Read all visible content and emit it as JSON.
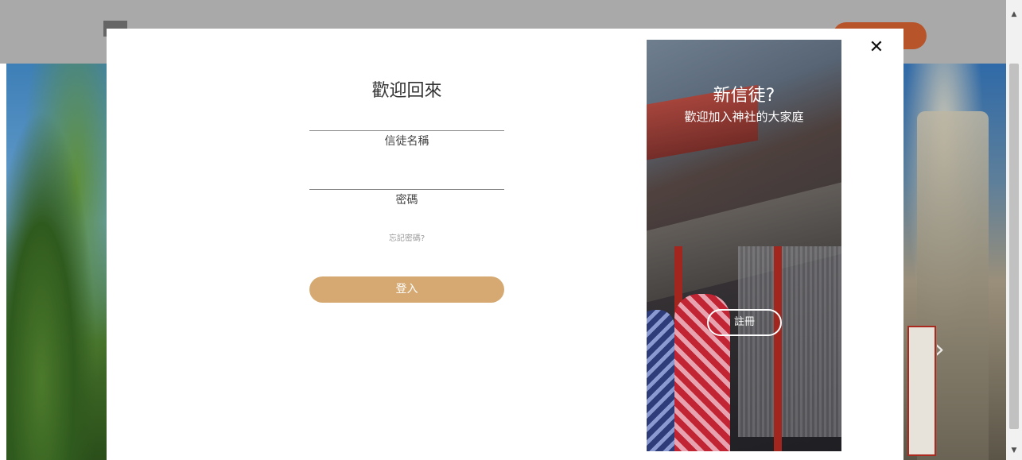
{
  "modal": {
    "close_symbol": "✕",
    "login": {
      "title": "歡迎回來",
      "username_label": "信徒名稱",
      "password_label": "密碼",
      "forgot_link": "忘記密碼?",
      "submit_label": "登入"
    },
    "signup_panel": {
      "title": "新信徒?",
      "subtitle": "歡迎加入神社的大家庭",
      "register_label": "註冊"
    }
  },
  "background": {
    "carousel_next": "›"
  },
  "colors": {
    "login_button": "#d5a971",
    "nav_bar": "#a9a9a9",
    "nav_pill": "#b8542a"
  }
}
